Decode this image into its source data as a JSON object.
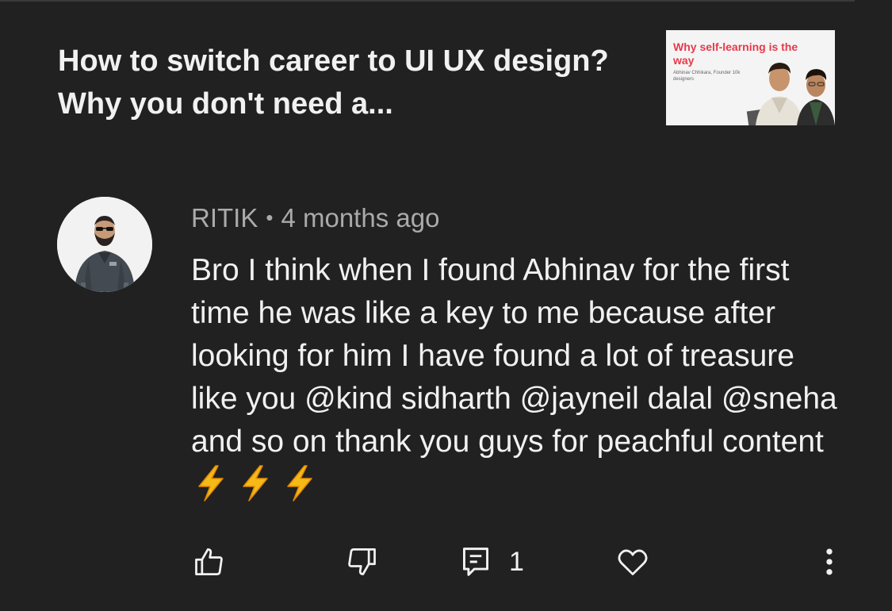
{
  "video": {
    "title": "How to switch career to UI UX design? Why you don't need a...",
    "thumbnail": {
      "headline": "Why self-learning is the way",
      "subtitle": "Abhinav Chhikara, Founder 10k designers"
    }
  },
  "comment": {
    "author": "RITIK",
    "separator": "•",
    "time": "4 months ago",
    "text": "Bro I think when I found Abhinav for the first time he was like a key to me because after looking for him I have found a lot of treasure like you @kind sidharth @jayneil dalal @sneha and so on thank you guys for peachful content",
    "emoji": [
      "high-voltage",
      "high-voltage",
      "high-voltage"
    ]
  },
  "actions": {
    "like_icon": "thumbs-up-icon",
    "dislike_icon": "thumbs-down-icon",
    "reply_icon": "comment-icon",
    "reply_count": "1",
    "heart_icon": "heart-icon",
    "more_icon": "more-vertical-icon"
  },
  "colors": {
    "background": "#212121",
    "text_primary": "#f1f1f1",
    "text_secondary": "#aaaaaa",
    "thumb_accent": "#e8394b",
    "bolt": "#f5b918"
  }
}
